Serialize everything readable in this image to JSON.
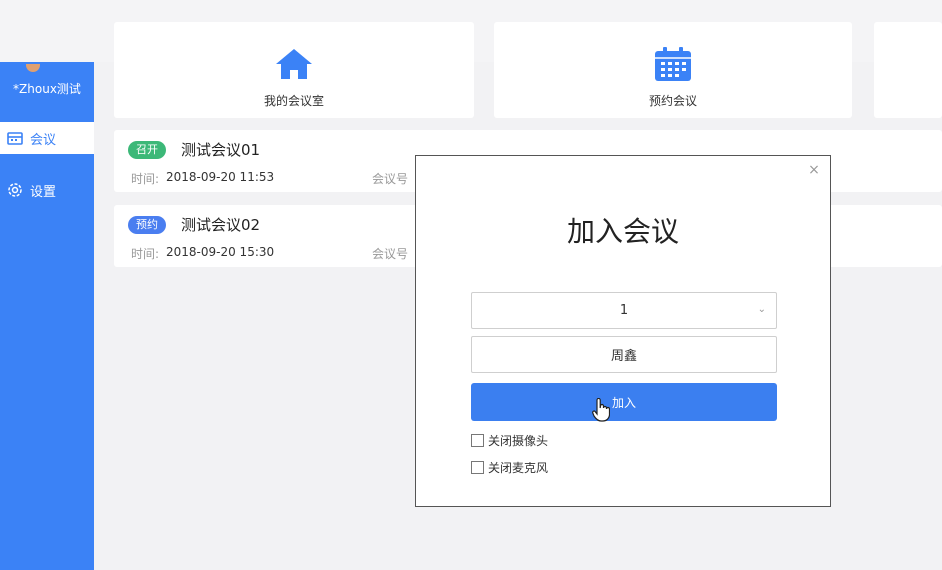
{
  "user": {
    "name": "*Zhoux测试"
  },
  "sidebar": {
    "items": [
      {
        "label": "会议",
        "icon": "calendar-icon"
      },
      {
        "label": "设置",
        "icon": "gear-icon"
      }
    ]
  },
  "tiles": [
    {
      "label": "我的会议室",
      "icon": "home-icon"
    },
    {
      "label": "预约会议",
      "icon": "calendar-grid-icon"
    }
  ],
  "meetings": [
    {
      "badge": "召开",
      "badge_color": "#3cb878",
      "name": "测试会议01",
      "time_label": "时间:",
      "time": "2018-09-20 11:53",
      "room_label": "会议号"
    },
    {
      "badge": "预约",
      "badge_color": "#4a7ef0",
      "name": "测试会议02",
      "time_label": "时间:",
      "time": "2018-09-20 15:30",
      "room_label": "会议号"
    }
  ],
  "modal": {
    "title": "加入会议",
    "close": "×",
    "meeting_select": "1",
    "name_value": "周鑫",
    "join_label": "加入",
    "options": [
      {
        "label": "关闭摄像头",
        "checked": false
      },
      {
        "label": "关闭麦克风",
        "checked": false
      }
    ]
  },
  "colors": {
    "accent": "#3b82f6",
    "button": "#3b7ff0"
  }
}
